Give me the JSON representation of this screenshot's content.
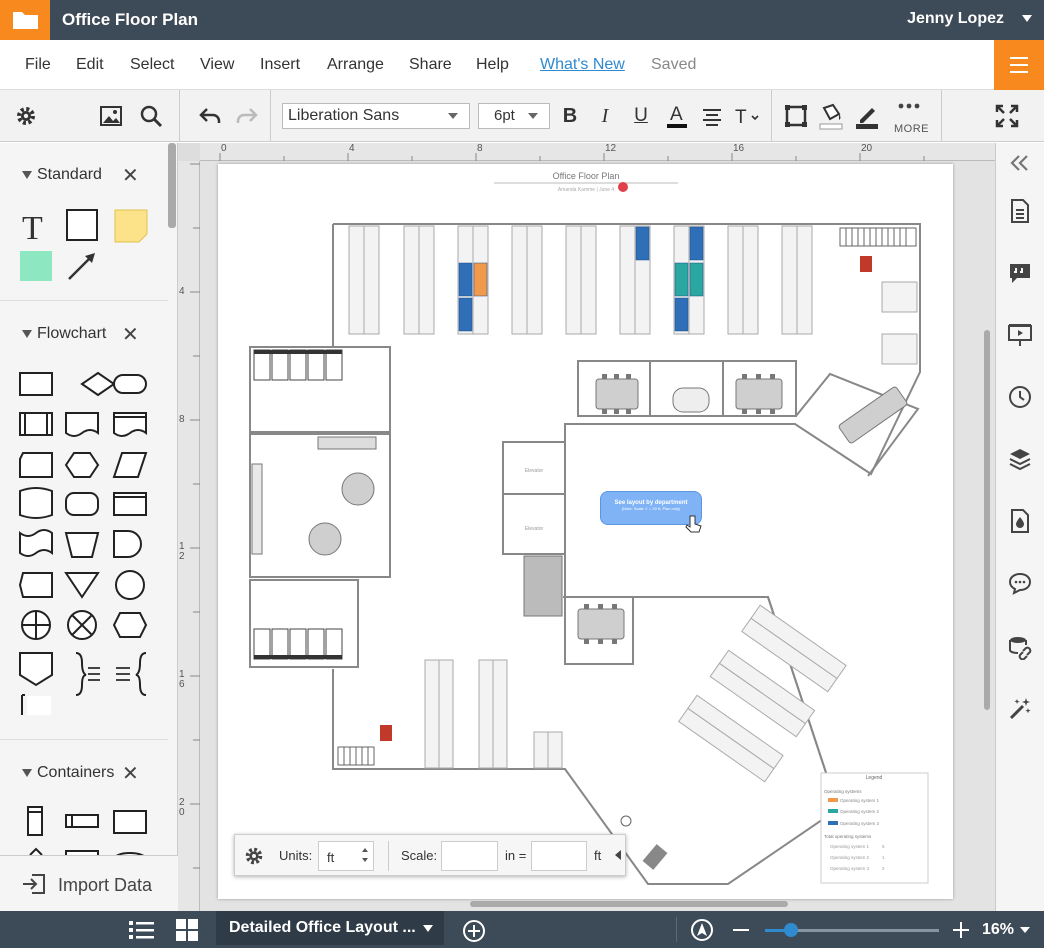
{
  "header": {
    "title": "Office Floor Plan",
    "user": "Jenny Lopez"
  },
  "menu": {
    "items": [
      "File",
      "Edit",
      "Select",
      "View",
      "Insert",
      "Arrange",
      "Share",
      "Help"
    ],
    "whats_new": "What's New",
    "status": "Saved"
  },
  "toolbar": {
    "font": "Liberation Sans",
    "font_size": "6pt",
    "more": "MORE"
  },
  "left_panel": {
    "sections": [
      {
        "name": "Standard"
      },
      {
        "name": "Flowchart"
      },
      {
        "name": "Containers"
      }
    ],
    "import_label": "Import Data"
  },
  "ruler": {
    "top": [
      "0",
      "4",
      "8",
      "12",
      "16",
      "20"
    ],
    "left": [
      "4",
      "8",
      "12",
      "16",
      "20"
    ]
  },
  "canvas": {
    "plan_title": "Office Floor Plan",
    "plan_subtitle": "Amanda Kamme | June 4",
    "callout": "See layout by department",
    "callout_sub": "(Note: Scale 1' = 20 ft, Plan only)",
    "room_elevator": "Elevator",
    "legend": {
      "title": "Legend",
      "group1": "Operating systems",
      "items1": [
        "Operating system 1",
        "Operating system 2",
        "Operating system 3"
      ],
      "group2": "Total operating systems",
      "items2": [
        "Operating system 1",
        "Operating system 2",
        "Operating system 3"
      ],
      "counts": [
        "5",
        "1",
        "2"
      ]
    },
    "colors": {
      "orange": "#f29a4b",
      "blue": "#2f6fb8",
      "teal": "#2aa7a0",
      "exit": "#c0392b"
    }
  },
  "units_bar": {
    "units_label": "Units:",
    "units_value": "ft",
    "scale_label": "Scale:",
    "in_label": "in =",
    "ft_label": "ft"
  },
  "status_bar": {
    "page_name": "Detailed Office Layout ...",
    "zoom": "16%"
  }
}
